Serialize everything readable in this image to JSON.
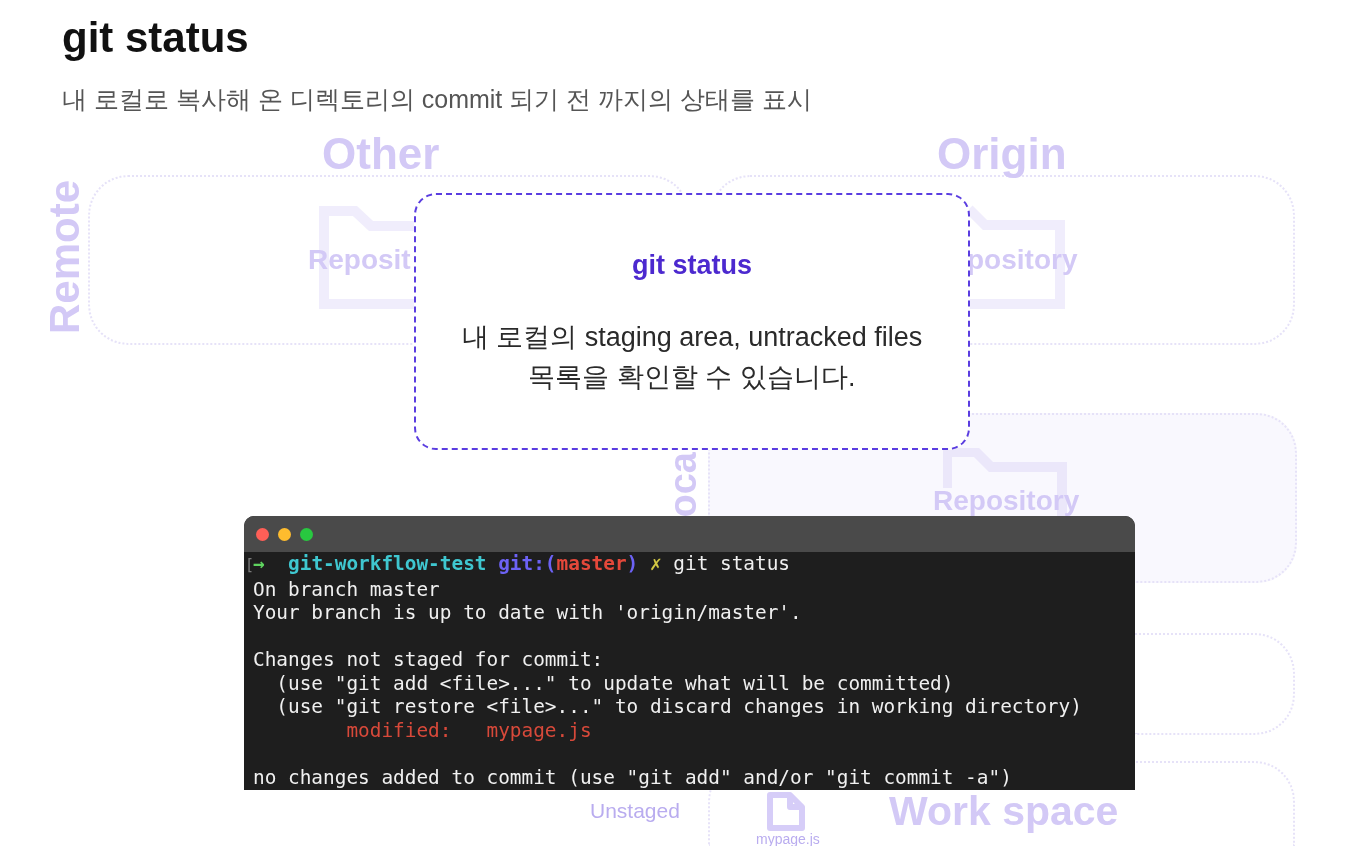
{
  "slide": {
    "title": "git status",
    "subtitle": "내 로컬로 복사해 온 디렉토리의 commit 되기 전 까지의 상태를 표시"
  },
  "diagram": {
    "remote_columns": [
      {
        "title": "Other",
        "repository_label": "Reposit"
      },
      {
        "title": "Origin",
        "repository_label": "pository"
      }
    ],
    "remote_label": "Remote",
    "local_label": "oca",
    "local_repository_label": "Repository",
    "unstaged_label": "Unstaged",
    "workspace_label": "Work space",
    "workspace_file": "mypage.js"
  },
  "callout": {
    "title": "git status",
    "lines": [
      "내 로컬의 staging area, untracked files",
      "목록을 확인할 수 있습니다."
    ]
  },
  "terminal": {
    "blocks": [
      {
        "lines": [
          {
            "segments": [
              {
                "kind": "dim",
                "text": "["
              },
              {
                "kind": "arrow",
                "text": "→  "
              },
              {
                "kind": "directory",
                "text": "git-workflow-test "
              },
              {
                "kind": "git",
                "text": "git:("
              },
              {
                "kind": "branch",
                "text": "master"
              },
              {
                "kind": "git",
                "text": ") "
              },
              {
                "kind": "dirty",
                "text": "✗"
              },
              {
                "kind": "plain",
                "text": " git status"
              }
            ]
          },
          {
            "segments": [
              {
                "kind": "plain",
                "text": "On branch master"
              }
            ]
          },
          {
            "segments": [
              {
                "kind": "plain",
                "text": "Your branch is up to date with 'origin/master'."
              }
            ]
          }
        ]
      },
      {
        "lines": [
          {
            "segments": [
              {
                "kind": "plain",
                "text": "Changes not staged for commit:"
              }
            ]
          },
          {
            "segments": [
              {
                "kind": "plain",
                "text": "  (use \"git add <file>...\" to update what will be committed)"
              }
            ]
          },
          {
            "segments": [
              {
                "kind": "plain",
                "text": "  (use \"git restore <file>...\" to discard changes in working directory)"
              }
            ]
          },
          {
            "segments": [
              {
                "kind": "modified",
                "text": "        modified:   mypage.js"
              }
            ]
          }
        ]
      },
      {
        "lines": [
          {
            "segments": [
              {
                "kind": "plain",
                "text": "no changes added to commit (use \"git add\" and/or \"git commit -a\")"
              }
            ]
          }
        ]
      }
    ]
  }
}
